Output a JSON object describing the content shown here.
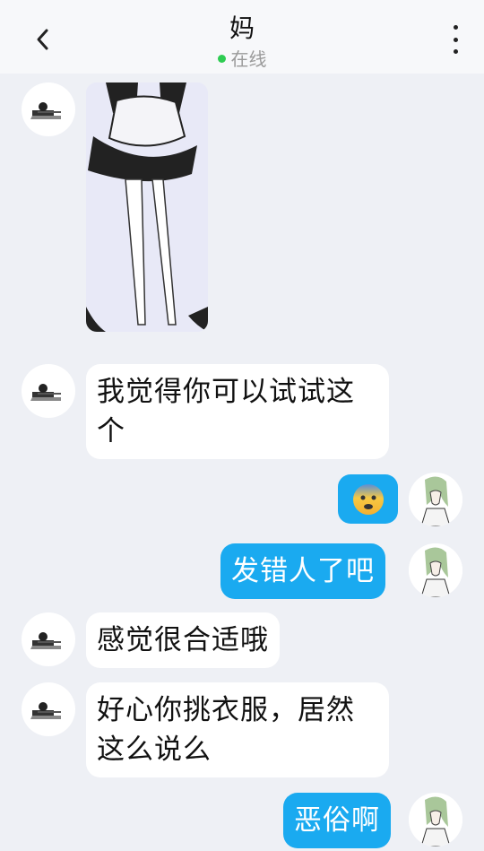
{
  "header": {
    "title": "妈",
    "status": "在线"
  },
  "messages": [
    {
      "sender": "mom",
      "type": "image",
      "alt": "maid-outfit-photo"
    },
    {
      "sender": "mom",
      "type": "text",
      "text": "我觉得你可以试试这个"
    },
    {
      "sender": "me",
      "type": "emoji",
      "emoji": "😨"
    },
    {
      "sender": "me",
      "type": "text",
      "text": "发错人了吧"
    },
    {
      "sender": "mom",
      "type": "text",
      "text": "感觉很合适哦"
    },
    {
      "sender": "mom",
      "type": "text",
      "text": "好心你挑衣服，居然这么说么"
    },
    {
      "sender": "me",
      "type": "text",
      "text": "恶俗啊"
    }
  ],
  "colors": {
    "outgoing_bubble": "#1aaaf0",
    "incoming_bubble": "#ffffff",
    "background": "#eef0f5",
    "online_dot": "#2ecc52"
  },
  "icons": [
    "back-arrow-icon",
    "more-vertical-icon",
    "fearful-face-emoji"
  ]
}
